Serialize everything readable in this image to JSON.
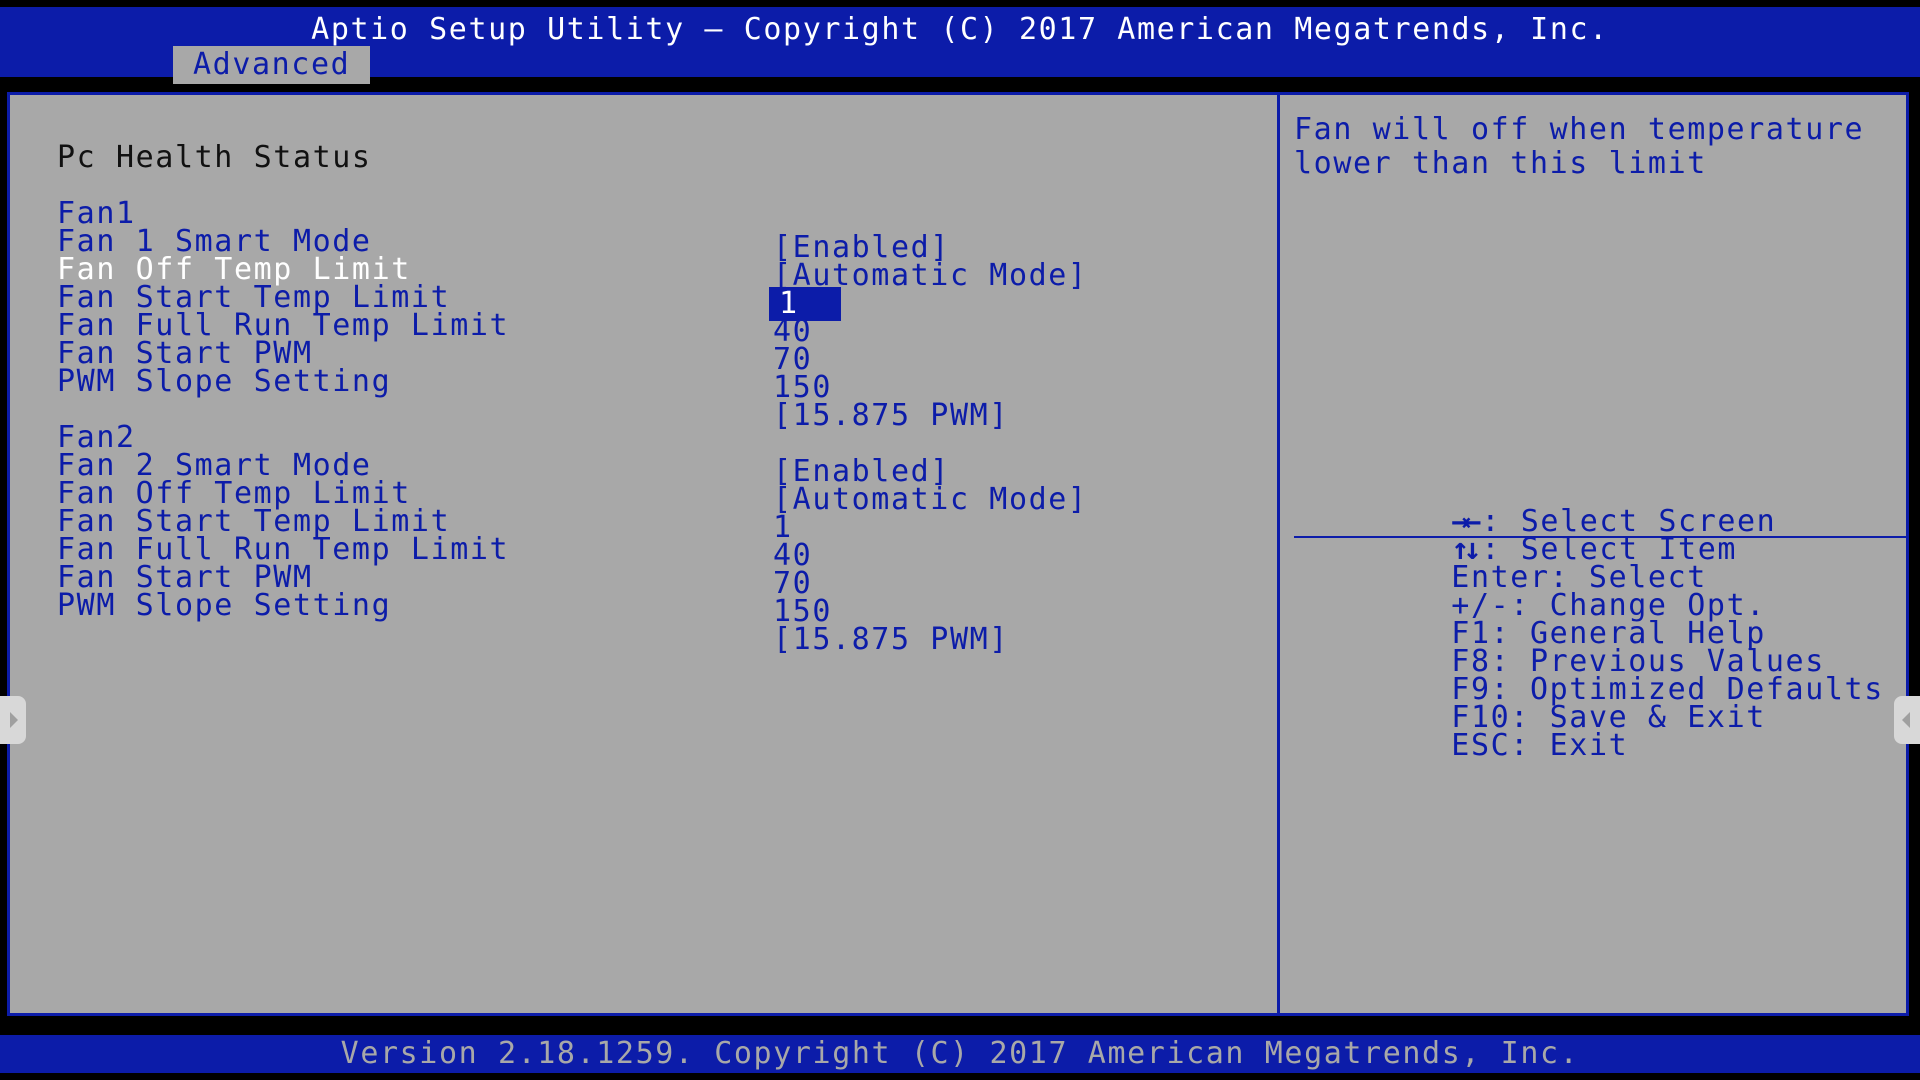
{
  "window": {
    "title": "Aptio Setup Utility – Copyright (C) 2017 American Megatrends, Inc.",
    "footer": "Version 2.18.1259. Copyright (C) 2017 American Megatrends, Inc."
  },
  "tabs": [
    {
      "label": "Advanced",
      "active": true
    }
  ],
  "page": {
    "heading": "Pc Health Status"
  },
  "fan1": {
    "label": "Fan1",
    "value": "[Enabled]",
    "settings": [
      {
        "label": "Fan 1 Smart Mode",
        "value": "[Automatic Mode]"
      },
      {
        "label": "Fan Off Temp Limit",
        "value": "1"
      },
      {
        "label": "Fan Start Temp Limit",
        "value": "40"
      },
      {
        "label": "Fan Full Run Temp Limit",
        "value": "70"
      },
      {
        "label": "Fan Start PWM",
        "value": "150"
      },
      {
        "label": "PWM Slope Setting",
        "value": "[15.875 PWM]"
      }
    ]
  },
  "fan2": {
    "label": "Fan2",
    "value": "[Enabled]",
    "settings": [
      {
        "label": "Fan 2 Smart Mode",
        "value": "[Automatic Mode]"
      },
      {
        "label": "Fan Off Temp Limit",
        "value": "1"
      },
      {
        "label": "Fan Start Temp Limit",
        "value": "40"
      },
      {
        "label": "Fan Full Run Temp Limit",
        "value": "70"
      },
      {
        "label": "Fan Start PWM",
        "value": "150"
      },
      {
        "label": "PWM Slope Setting",
        "value": "[15.875 PWM]"
      }
    ]
  },
  "help": {
    "text": "Fan will off when temperature\nlower than this limit"
  },
  "keys": [
    {
      "key": "→←",
      "desc": ": Select Screen"
    },
    {
      "key": "↑↓",
      "desc": ": Select Item"
    },
    {
      "key": "Enter",
      "desc": ": Select"
    },
    {
      "key": "+/-",
      "desc": ": Change Opt."
    },
    {
      "key": "F1",
      "desc": ": General Help"
    },
    {
      "key": "F8",
      "desc": ": Previous Values"
    },
    {
      "key": "F9",
      "desc": ": Optimized Defaults"
    },
    {
      "key": "F10",
      "desc": ": Save & Exit"
    },
    {
      "key": "ESC",
      "desc": ": Exit"
    }
  ],
  "colors": {
    "bios_blue": "#0c1ca9",
    "panel_gray": "#a8a8a8",
    "highlight_text": "#ffffff"
  }
}
